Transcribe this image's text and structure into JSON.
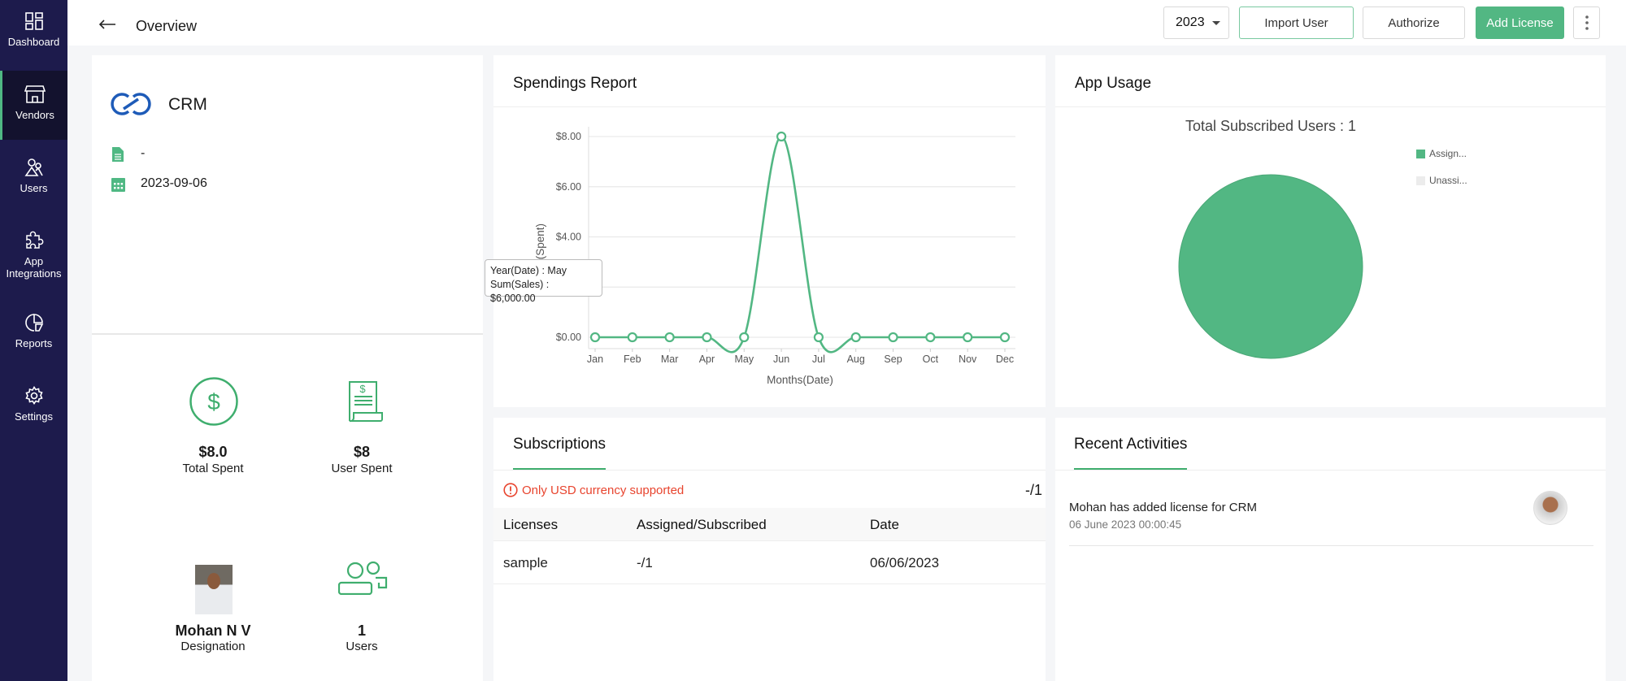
{
  "sidebar": {
    "items": [
      {
        "label": "Dashboard",
        "icon": "dashboard-icon"
      },
      {
        "label": "Vendors",
        "icon": "store-icon",
        "active": true
      },
      {
        "label": "Users",
        "icon": "users-icon"
      },
      {
        "label": "App Integrations",
        "icon": "puzzle-icon"
      },
      {
        "label": "Reports",
        "icon": "pie-report-icon"
      },
      {
        "label": "Settings",
        "icon": "gear-icon"
      }
    ]
  },
  "header": {
    "title": "Overview",
    "year": "2023",
    "import_user": "Import User",
    "authorize": "Authorize",
    "add_license": "Add License"
  },
  "vendor": {
    "name": "CRM",
    "description": "-",
    "date": "2023-09-06",
    "stats": {
      "total_spent_value": "$8.0",
      "total_spent_label": "Total Spent",
      "user_spent_value": "$8",
      "user_spent_label": "User Spent",
      "owner_name": "Mohan N V",
      "owner_role": "Designation",
      "users_value": "1",
      "users_label": "Users"
    }
  },
  "colors": {
    "accent": "#4fb883",
    "sidebar": "#1d1b4c",
    "error": "#e8442e",
    "logo": "#1e5bb8"
  },
  "spendings": {
    "title": "Spendings Report",
    "tooltip_line1": "Year(Date) : May",
    "tooltip_line2": "Sum(Sales) : $6,000.00"
  },
  "chart_data": {
    "type": "line",
    "categories": [
      "Jan",
      "Feb",
      "Mar",
      "Apr",
      "May",
      "Jun",
      "Jul",
      "Aug",
      "Sep",
      "Oct",
      "Nov",
      "Dec"
    ],
    "values": [
      0,
      0,
      0,
      0,
      0,
      8,
      0,
      0,
      0,
      0,
      0,
      0
    ],
    "xlabel": "Months(Date)",
    "ylabel": "um(Spent)",
    "yticks": [
      "$0.00",
      "$2.00",
      "$4.00",
      "$6.00",
      "$8.00"
    ],
    "visible_yticks": [
      "$0.00",
      "$4.00",
      "$6.00",
      "$8.00"
    ],
    "ylim": [
      0,
      8
    ],
    "grid": true,
    "smooth": true
  },
  "app_usage": {
    "title": "App Usage",
    "subtitle": "Total Subscribed Users : 1",
    "chart_data": {
      "type": "pie",
      "legend": [
        "Assign...",
        "Unassi..."
      ],
      "values": [
        1,
        0
      ],
      "colors": [
        "#52b783",
        "#ececec"
      ],
      "legend_position": "right"
    }
  },
  "subscriptions": {
    "title": "Subscriptions",
    "warning": "Only USD currency supported",
    "summary": "-/1",
    "columns": [
      "Licenses",
      "Assigned/Subscribed",
      "Date"
    ],
    "rows": [
      [
        "sample",
        "-/1",
        "06/06/2023"
      ]
    ]
  },
  "activities": {
    "title": "Recent Activities",
    "items": [
      {
        "text": "Mohan has added license for CRM",
        "time": "06 June 2023 00:00:45"
      }
    ]
  }
}
